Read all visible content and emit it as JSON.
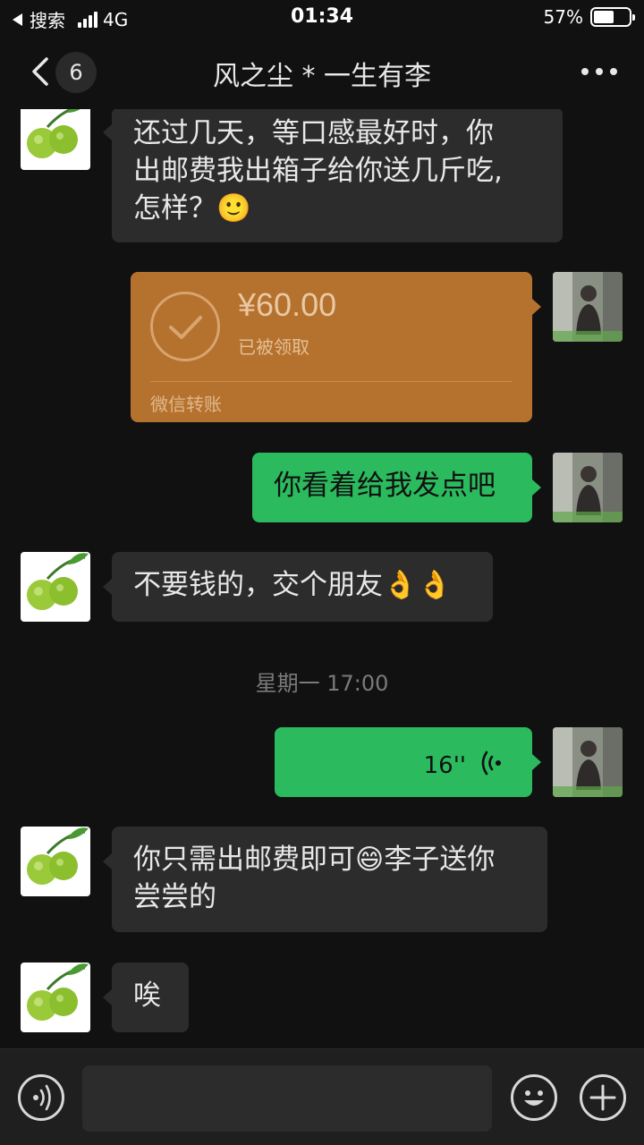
{
  "status_bar": {
    "back_app": "搜索",
    "network": "4G",
    "time": "01:34",
    "battery_percent": "57%",
    "battery_level": 0.57
  },
  "nav": {
    "unread_count": "6",
    "title": "风之尘 * 一生有李"
  },
  "messages": {
    "m1": {
      "line1": "还过几天，等口感最好时，你",
      "line2": "出邮费我出箱子给你送几斤吃,",
      "line3": "怎样？🙂"
    },
    "transfer": {
      "amount": "¥60.00",
      "status": "已被领取",
      "label": "微信转账"
    },
    "m2": {
      "text": "你看着给我发点吧"
    },
    "m3": {
      "text": "不要钱的，交个朋友👌👌"
    },
    "time_separator": "星期一 17:00",
    "voice": {
      "duration": "16''"
    },
    "m4": {
      "line1": "你只需出邮费即可😄李子送你",
      "line2": "尝尝的"
    },
    "m5": {
      "text": "唉"
    }
  },
  "input": {
    "value": "",
    "placeholder": ""
  },
  "colors": {
    "background": "#111111",
    "incoming_bubble": "#2c2c2c",
    "outgoing_bubble": "#2bba5e",
    "transfer_card": "#b5722e"
  },
  "icons": {
    "back": "chevron-left-icon",
    "more": "ellipsis-icon",
    "voice_mode": "voice-icon",
    "emoji": "emoji-icon",
    "plus": "plus-icon"
  }
}
